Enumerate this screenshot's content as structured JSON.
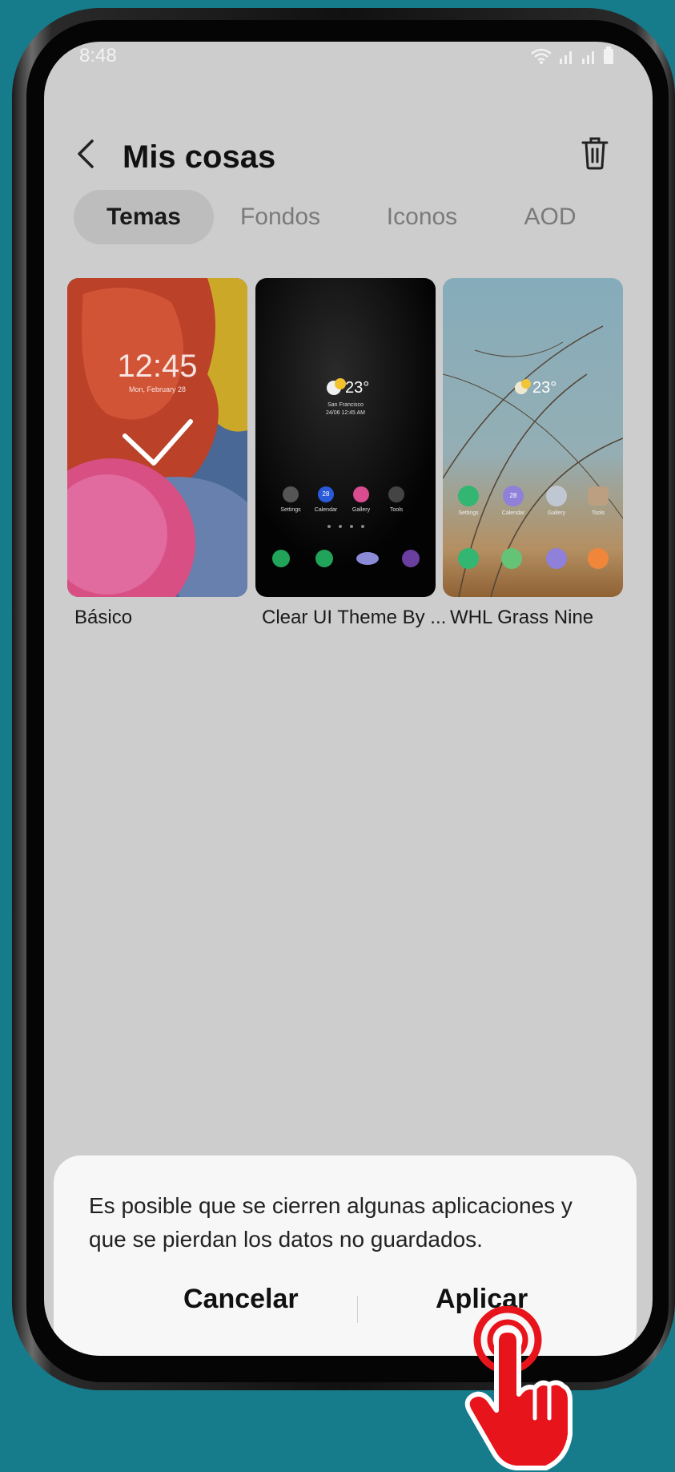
{
  "status_bar": {
    "time": "8:48"
  },
  "header": {
    "title": "Mis cosas"
  },
  "tabs": [
    {
      "label": "Temas"
    },
    {
      "label": "Fondos"
    },
    {
      "label": "Iconos"
    },
    {
      "label": "AOD"
    }
  ],
  "themes": [
    {
      "name": "Básico",
      "selected": true,
      "preview_time": "12:45",
      "preview_date": "Mon, February 28"
    },
    {
      "name": "Clear UI Theme By ...",
      "selected": false,
      "preview_temp": "23°",
      "preview_city": "San Francisco",
      "preview_datetime": "24/06 12:45 AM",
      "apps": [
        "Settings",
        "Calendar",
        "Gallery",
        "Tools"
      ],
      "calendar_day": "28"
    },
    {
      "name": "WHL Grass Nine",
      "selected": false,
      "preview_temp": "23°",
      "apps": [
        "Settings",
        "Calendar",
        "Gallery",
        "Tools"
      ],
      "calendar_day": "28"
    }
  ],
  "dialog": {
    "message": "Es posible que se cierren algunas aplicaciones y que se pierdan los datos no guardados.",
    "cancel_label": "Cancelar",
    "apply_label": "Aplicar"
  },
  "colors": {
    "background": "#167c8c",
    "screen": "#cdcdcd",
    "dialog": "#f7f7f7",
    "pointer": "#e8141c"
  }
}
